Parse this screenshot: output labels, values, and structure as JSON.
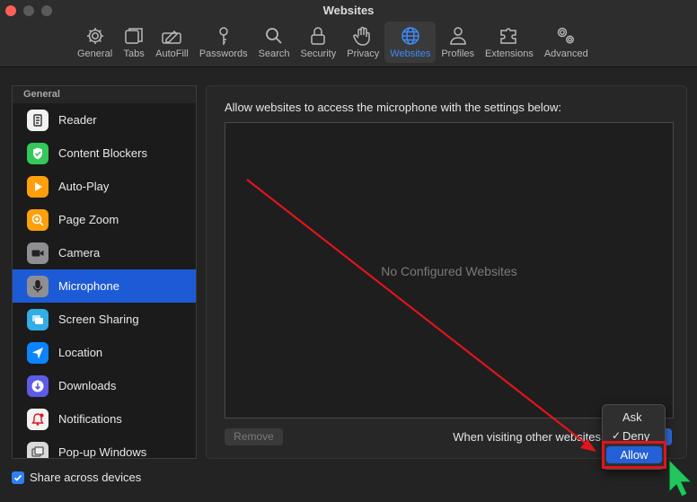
{
  "window": {
    "title": "Websites"
  },
  "toolbar": {
    "tabs": [
      {
        "label": "General",
        "icon": "gear-icon"
      },
      {
        "label": "Tabs",
        "icon": "tabs-icon"
      },
      {
        "label": "AutoFill",
        "icon": "pencil-icon"
      },
      {
        "label": "Passwords",
        "icon": "key-icon"
      },
      {
        "label": "Search",
        "icon": "search-icon"
      },
      {
        "label": "Security",
        "icon": "lock-icon"
      },
      {
        "label": "Privacy",
        "icon": "hand-icon"
      },
      {
        "label": "Websites",
        "icon": "globe-icon",
        "active": true
      },
      {
        "label": "Profiles",
        "icon": "person-icon"
      },
      {
        "label": "Extensions",
        "icon": "puzzle-icon"
      },
      {
        "label": "Advanced",
        "icon": "gears-icon"
      }
    ]
  },
  "sidebar": {
    "header": "General",
    "items": [
      {
        "label": "Reader",
        "icon": "reader-icon",
        "color": "#f2f2f2"
      },
      {
        "label": "Content Blockers",
        "icon": "shield-check-icon",
        "color": "#34c759"
      },
      {
        "label": "Auto-Play",
        "icon": "play-icon",
        "color": "#ff9f0a"
      },
      {
        "label": "Page Zoom",
        "icon": "zoom-icon",
        "color": "#ff9f0a"
      },
      {
        "label": "Camera",
        "icon": "camera-icon",
        "color": "#8e8e93"
      },
      {
        "label": "Microphone",
        "icon": "microphone-icon",
        "color": "#8e8e93",
        "selected": true
      },
      {
        "label": "Screen Sharing",
        "icon": "screen-share-icon",
        "color": "#32ade6"
      },
      {
        "label": "Location",
        "icon": "location-icon",
        "color": "#0a84ff"
      },
      {
        "label": "Downloads",
        "icon": "download-icon",
        "color": "#5e5ce6"
      },
      {
        "label": "Notifications",
        "icon": "bell-icon",
        "color": "#f2f2f2"
      },
      {
        "label": "Pop-up Windows",
        "icon": "popup-icon",
        "color": "#d9d9d9"
      }
    ]
  },
  "share": {
    "label": "Share across devices",
    "checked": true
  },
  "main": {
    "title": "Allow websites to access the microphone with the settings below:",
    "empty_text": "No Configured Websites",
    "remove_label": "Remove",
    "visiting_label": "When visiting other websites"
  },
  "menu": {
    "items": [
      {
        "label": "Ask",
        "checked": false
      },
      {
        "label": "Deny",
        "checked": true
      },
      {
        "label": "Allow",
        "checked": false,
        "highlighted": true
      }
    ],
    "check_glyph": "✓"
  },
  "colors": {
    "accent": "#1d5bd6",
    "annotation": "#e0141e",
    "cursor": "#22c55e"
  }
}
